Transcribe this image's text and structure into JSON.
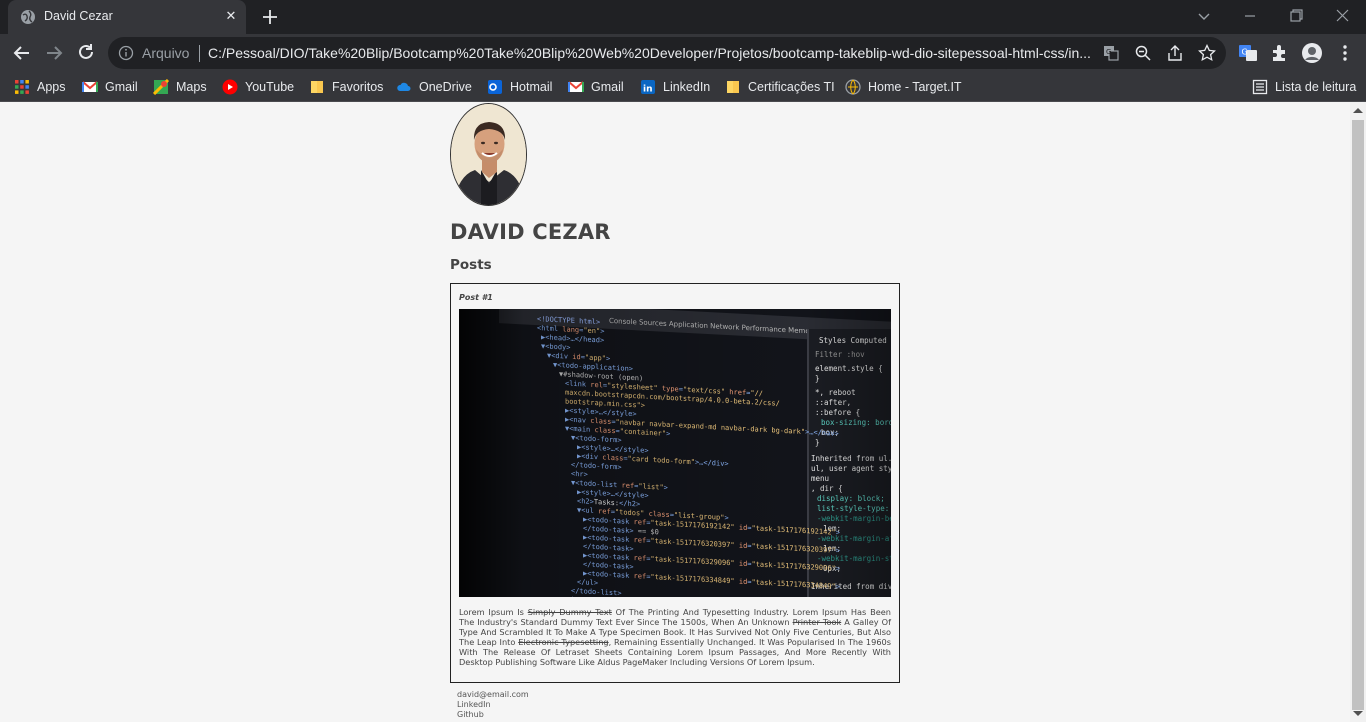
{
  "browser": {
    "tab_title": "David Cezar",
    "address_scheme": "Arquivo",
    "url": "C:/Pessoal/DIO/Take%20Blip/Bootcamp%20Take%20Blip%20Web%20Developer/Projetos/bootcamp-takeblip-wd-dio-sitepessoal-html-css/in...",
    "bookmarks": [
      "Apps",
      "Gmail",
      "Maps",
      "YouTube",
      "Favoritos",
      "OneDrive",
      "Hotmail",
      "Gmail",
      "LinkedIn",
      "Certificações TI",
      "Home - Target.IT"
    ],
    "reading_list": "Lista de leitura"
  },
  "page": {
    "name": "DAVID CEZAR",
    "posts_heading": "Posts",
    "post": {
      "title": "Post #1",
      "image_alt": "code-editor-screenshot",
      "text_parts": [
        "Lorem ipsum is ",
        "simply dummy text",
        " of the printing and typesetting industry. Lorem Ipsum has been the industry's standard dummy text ever since the 1500s, when an unknown ",
        "printer took",
        " a galley of type and scrambled it to make a type specimen book. It has survived not only five centuries, but also the leap into ",
        "electronic typesetting",
        ", remaining essentially unchanged. It was popularised in the 1960s with the release of Letraset sheets containing Lorem Ipsum passages, and more recently with desktop publishing software like Aldus PageMaker including versions of Lorem Ipsum."
      ]
    },
    "footer": {
      "email": "david@email.com",
      "linkedin": "LinkedIn",
      "github": "Github"
    }
  },
  "colors": {
    "chrome_bg": "#35363a",
    "tabstrip_bg": "#202124",
    "page_bg": "#f5f5f5"
  }
}
